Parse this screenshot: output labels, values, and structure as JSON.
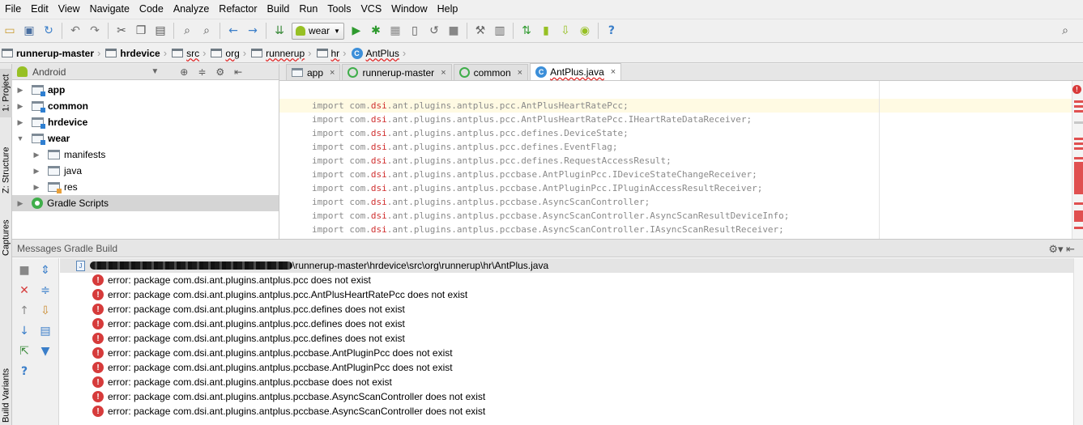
{
  "menu": [
    "File",
    "Edit",
    "View",
    "Navigate",
    "Code",
    "Analyze",
    "Refactor",
    "Build",
    "Run",
    "Tools",
    "VCS",
    "Window",
    "Help"
  ],
  "toolbar": {
    "run_config": "wear",
    "icons": [
      "open-folder-icon",
      "save-icon",
      "sync-icon",
      "undo-icon",
      "redo-icon",
      "cut-icon",
      "copy-icon",
      "paste-icon",
      "find-icon",
      "replace-icon",
      "back-icon",
      "forward-icon",
      "make-project-icon",
      "run-icon",
      "debug-icon",
      "coverage-icon",
      "attach-debugger-icon",
      "rerun-icon",
      "stop-icon",
      "project-structure-icon",
      "gradle-sync-icon",
      "avd-manager-icon",
      "sdk-manager-icon",
      "android-monitor-icon",
      "help-icon",
      "search-everywhere-icon"
    ]
  },
  "breadcrumbs": [
    {
      "label": "runnerup-master",
      "squiggly": false
    },
    {
      "label": "hrdevice",
      "squiggly": false
    },
    {
      "label": "src",
      "squiggly": true
    },
    {
      "label": "org",
      "squiggly": true
    },
    {
      "label": "runnerup",
      "squiggly": true
    },
    {
      "label": "hr",
      "squiggly": true
    },
    {
      "label": "AntPlus",
      "squiggly": true
    }
  ],
  "left_stripe": {
    "project_tab": "1: Project",
    "structure_tab": "Z: Structure",
    "captures_tab": "Captures",
    "build_variants_tab": "Build Variants"
  },
  "project_panel": {
    "view_mode": "Android",
    "tree": [
      {
        "label": "app",
        "bold": true,
        "level": 0,
        "expanded": false,
        "kind": "module"
      },
      {
        "label": "common",
        "bold": true,
        "level": 0,
        "expanded": false,
        "kind": "module"
      },
      {
        "label": "hrdevice",
        "bold": true,
        "level": 0,
        "expanded": false,
        "kind": "module"
      },
      {
        "label": "wear",
        "bold": true,
        "level": 0,
        "expanded": true,
        "kind": "module"
      },
      {
        "label": "manifests",
        "bold": false,
        "level": 1,
        "expanded": false,
        "kind": "folder"
      },
      {
        "label": "java",
        "bold": false,
        "level": 1,
        "expanded": false,
        "kind": "folder"
      },
      {
        "label": "res",
        "bold": false,
        "level": 1,
        "expanded": false,
        "kind": "res"
      },
      {
        "label": "Gradle Scripts",
        "bold": false,
        "level": 0,
        "expanded": false,
        "kind": "gradle",
        "selected": true
      }
    ]
  },
  "editor": {
    "tabs": [
      {
        "label": "app",
        "active": false,
        "icon": "module"
      },
      {
        "label": "runnerup-master",
        "active": false,
        "icon": "gradle"
      },
      {
        "label": "common",
        "active": false,
        "icon": "gradle"
      },
      {
        "label": "AntPlus.java",
        "active": true,
        "icon": "class"
      }
    ],
    "close_glyph": "×",
    "lines": [
      {
        "kw": "import ",
        "pre": "com.",
        "red": "dsi",
        "post": ".ant.plugins.antplus.pcc.AntPlusHeartRatePcc;",
        "current": true
      },
      {
        "kw": "import ",
        "pre": "com.",
        "red": "dsi",
        "post": ".ant.plugins.antplus.pcc.AntPlusHeartRatePcc.IHeartRateDataReceiver;"
      },
      {
        "kw": "import ",
        "pre": "com.",
        "red": "dsi",
        "post": ".ant.plugins.antplus.pcc.defines.DeviceState;"
      },
      {
        "kw": "import ",
        "pre": "com.",
        "red": "dsi",
        "post": ".ant.plugins.antplus.pcc.defines.EventFlag;"
      },
      {
        "kw": "import ",
        "pre": "com.",
        "red": "dsi",
        "post": ".ant.plugins.antplus.pcc.defines.RequestAccessResult;"
      },
      {
        "kw": "import ",
        "pre": "com.",
        "red": "dsi",
        "post": ".ant.plugins.antplus.pccbase.AntPluginPcc.IDeviceStateChangeReceiver;"
      },
      {
        "kw": "import ",
        "pre": "com.",
        "red": "dsi",
        "post": ".ant.plugins.antplus.pccbase.AntPluginPcc.IPluginAccessResultReceiver;"
      },
      {
        "kw": "import ",
        "pre": "com.",
        "red": "dsi",
        "post": ".ant.plugins.antplus.pccbase.AsyncScanController;"
      },
      {
        "kw": "import ",
        "pre": "com.",
        "red": "dsi",
        "post": ".ant.plugins.antplus.pccbase.AsyncScanController.AsyncScanResultDeviceInfo;"
      },
      {
        "kw": "import ",
        "pre": "com.",
        "red": "dsi",
        "post": ".ant.plugins.antplus.pccbase.AsyncScanController.IAsyncScanResultReceiver;"
      }
    ]
  },
  "messages": {
    "title": "Messages Gradle Build",
    "file_path": "\\runnerup-master\\hrdevice\\src\\org\\runnerup\\hr\\AntPlus.java",
    "errors": [
      "error: package com.dsi.ant.plugins.antplus.pcc does not exist",
      "error: package com.dsi.ant.plugins.antplus.pcc.AntPlusHeartRatePcc does not exist",
      "error: package com.dsi.ant.plugins.antplus.pcc.defines does not exist",
      "error: package com.dsi.ant.plugins.antplus.pcc.defines does not exist",
      "error: package com.dsi.ant.plugins.antplus.pcc.defines does not exist",
      "error: package com.dsi.ant.plugins.antplus.pccbase.AntPluginPcc does not exist",
      "error: package com.dsi.ant.plugins.antplus.pccbase.AntPluginPcc does not exist",
      "error: package com.dsi.ant.plugins.antplus.pccbase does not exist",
      "error: package com.dsi.ant.plugins.antplus.pccbase.AsyncScanController does not exist",
      "error: package com.dsi.ant.plugins.antplus.pccbase.AsyncScanController does not exist"
    ]
  },
  "colors": {
    "error_red": "#d63b3b",
    "android_green": "#97c024",
    "current_line": "#fffae3"
  }
}
